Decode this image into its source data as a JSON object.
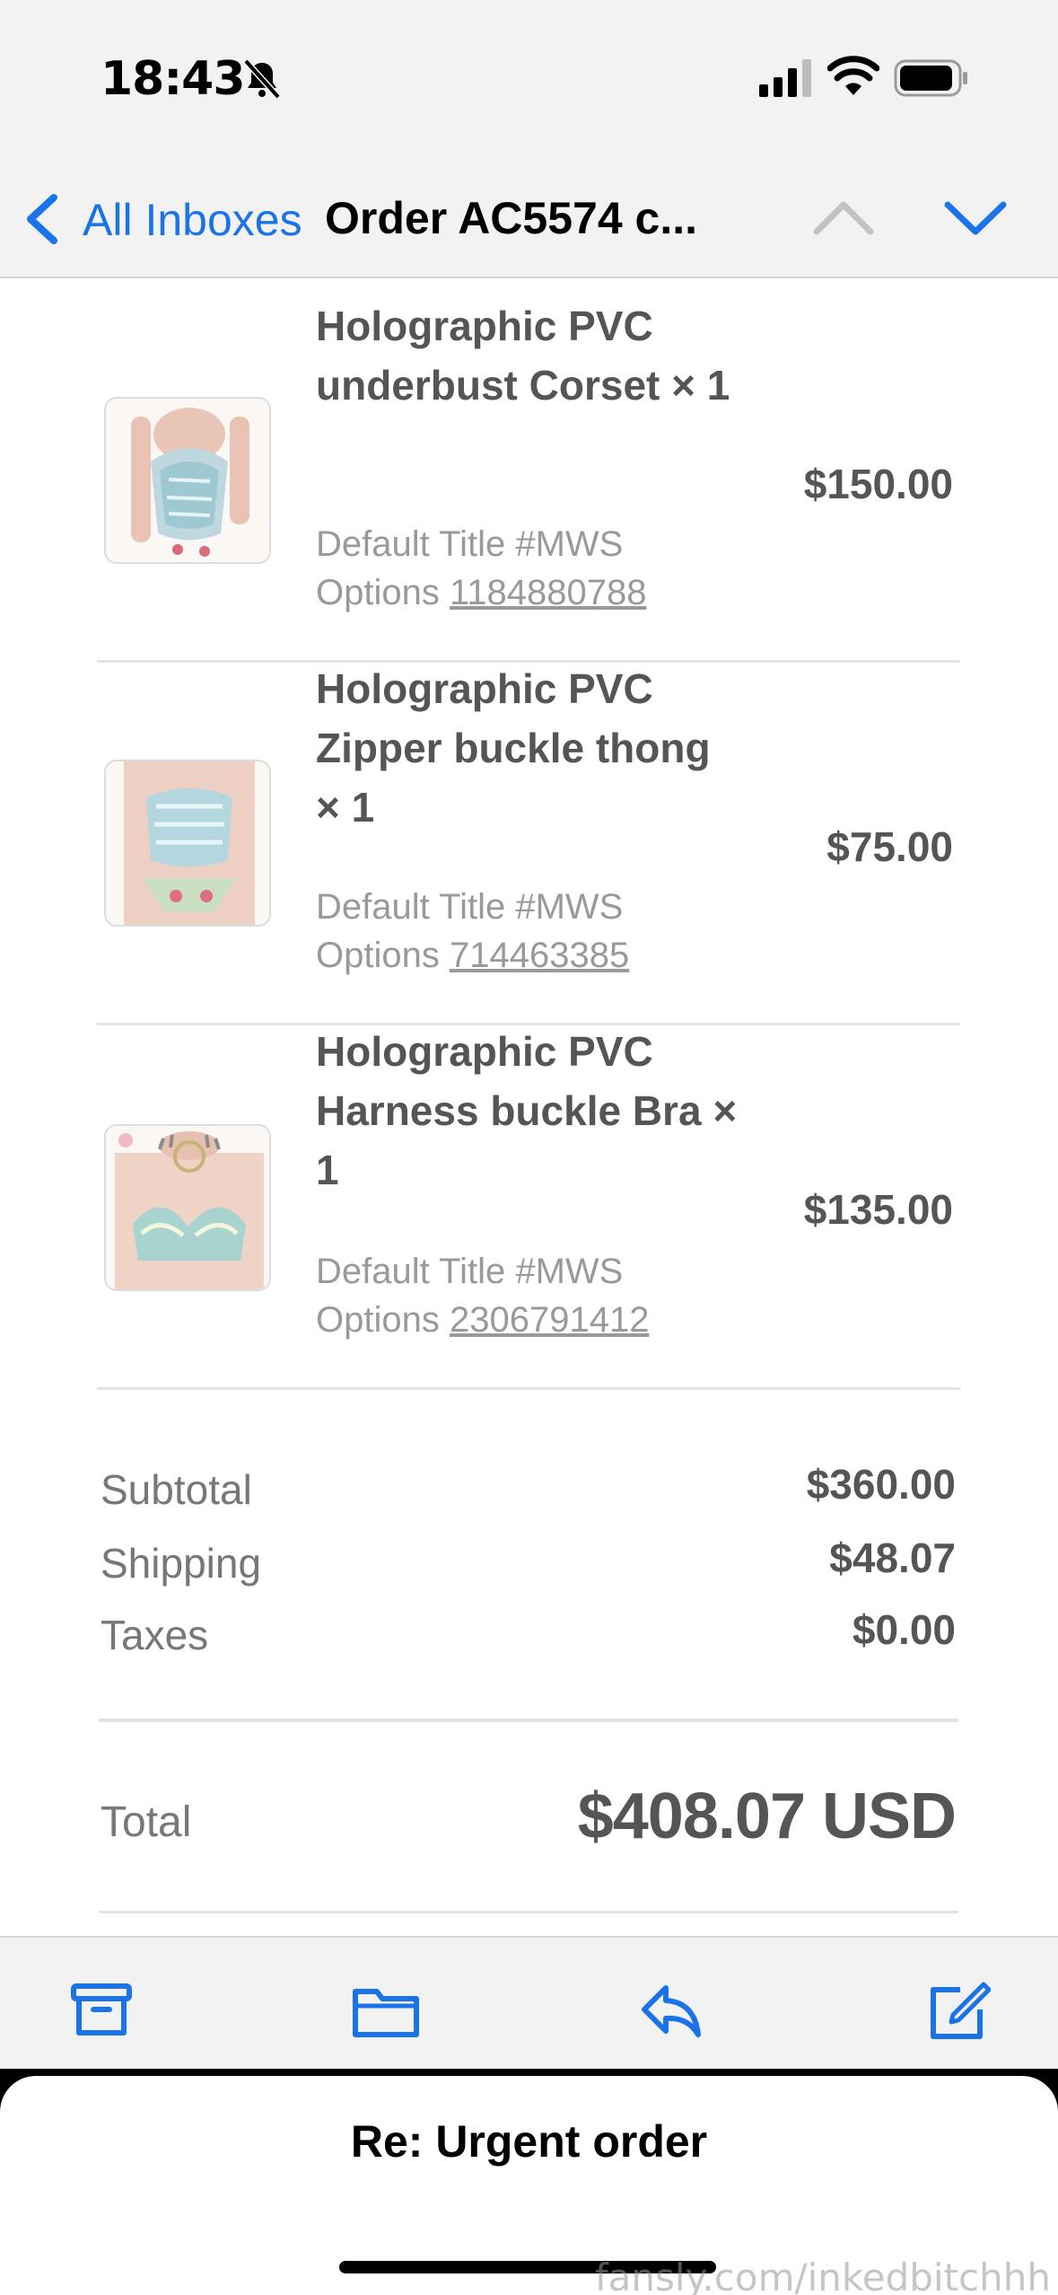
{
  "status_bar": {
    "time": "18:43"
  },
  "nav": {
    "back_label": "All Inboxes",
    "title": "Order AC5574 c..."
  },
  "items": [
    {
      "name": "Holographic PVC underbust Corset × 1",
      "variant": "Default Title #MWS",
      "options_label": "Options",
      "options_id": "1184880788",
      "price": "$150.00"
    },
    {
      "name": "Holographic PVC Zipper buckle thong × 1",
      "variant": "Default Title #MWS",
      "options_label": "Options",
      "options_id": "714463385",
      "price": "$75.00"
    },
    {
      "name": "Holographic PVC Harness buckle Bra × 1",
      "variant": "Default Title #MWS",
      "options_label": "Options",
      "options_id": "2306791412",
      "price": "$135.00"
    }
  ],
  "summary": {
    "subtotal_label": "Subtotal",
    "subtotal": "$360.00",
    "shipping_label": "Shipping",
    "shipping": "$48.07",
    "taxes_label": "Taxes",
    "taxes": "$0.00",
    "total_label": "Total",
    "total": "$408.07 USD"
  },
  "toolbar": {
    "icons": [
      "archive-icon",
      "folder-icon",
      "reply-icon",
      "compose-icon"
    ]
  },
  "draft": {
    "title": "Re: Urgent order"
  },
  "watermark": "fansly.com/inkedbitchhh",
  "colors": {
    "accent": "#1a73e8",
    "text": "#555555",
    "muted": "#999999"
  }
}
